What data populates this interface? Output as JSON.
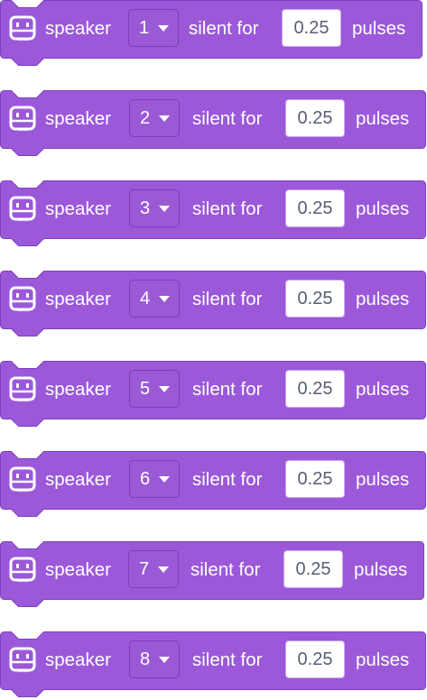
{
  "theme": {
    "block_fill": "#9b59d9",
    "block_stroke": "#7d3fbf",
    "dropdown_fill": "#9a5ad6",
    "text_color": "#ffffff",
    "input_text_color": "#575e75"
  },
  "blocks": [
    {
      "icon": "robot-icon",
      "label_pre": "speaker",
      "port": "1",
      "label_mid": "silent for",
      "value": "0.25",
      "label_post": "pulses"
    },
    {
      "icon": "robot-icon",
      "label_pre": "speaker",
      "port": "2",
      "label_mid": "silent for",
      "value": "0.25",
      "label_post": "pulses"
    },
    {
      "icon": "robot-icon",
      "label_pre": "speaker",
      "port": "3",
      "label_mid": "silent for",
      "value": "0.25",
      "label_post": "pulses"
    },
    {
      "icon": "robot-icon",
      "label_pre": "speaker",
      "port": "4",
      "label_mid": "silent for",
      "value": "0.25",
      "label_post": "pulses"
    },
    {
      "icon": "robot-icon",
      "label_pre": "speaker",
      "port": "5",
      "label_mid": "silent for",
      "value": "0.25",
      "label_post": "pulses"
    },
    {
      "icon": "robot-icon",
      "label_pre": "speaker",
      "port": "6",
      "label_mid": "silent for",
      "value": "0.25",
      "label_post": "pulses"
    },
    {
      "icon": "robot-icon",
      "label_pre": "speaker",
      "port": "7",
      "label_mid": "silent for",
      "value": "0.25",
      "label_post": "pulses"
    },
    {
      "icon": "robot-icon",
      "label_pre": "speaker",
      "port": "8",
      "label_mid": "silent for",
      "value": "0.25",
      "label_post": "pulses"
    }
  ]
}
